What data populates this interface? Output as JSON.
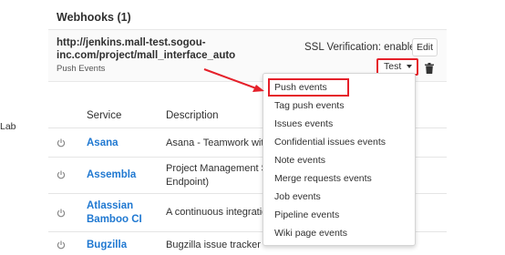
{
  "webhooks": {
    "section_title": "Webhooks (1)",
    "hook": {
      "url_line1": "http://jenkins.mall-test.sogou-",
      "url_line2": "inc.com/project/mall_interface_auto",
      "events": "Push Events",
      "ssl": "SSL Verification: enabled",
      "edit_label": "Edit",
      "test_label": "Test"
    }
  },
  "sidebar_fragment": "Lab",
  "services_table": {
    "headers": [
      "Service",
      "Description"
    ],
    "rows": [
      {
        "name_line1": "Asana",
        "name_line2": "",
        "desc_line1": "Asana - Teamwork without",
        "desc_line2": ""
      },
      {
        "name_line1": "Assembla",
        "name_line2": "",
        "desc_line1": "Project Management Sof",
        "desc_line2": "Endpoint)"
      },
      {
        "name_line1": "Atlassian",
        "name_line2": "Bamboo CI",
        "desc_line1": "A continuous integration",
        "desc_line2": ""
      },
      {
        "name_line1": "Bugzilla",
        "name_line2": "",
        "desc_line1": "Bugzilla issue tracker",
        "desc_line2": ""
      }
    ]
  },
  "test_dropdown": {
    "items": [
      "Push events",
      "Tag push events",
      "Issues events",
      "Confidential issues events",
      "Note events",
      "Merge requests events",
      "Job events",
      "Pipeline events",
      "Wiki page events"
    ]
  },
  "colors": {
    "annotation_red": "#e5202a",
    "link_blue": "#1f78d1"
  }
}
